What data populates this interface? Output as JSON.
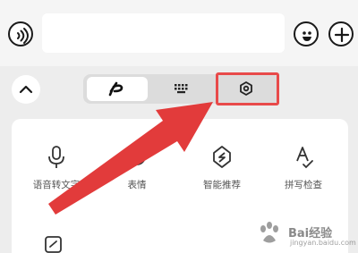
{
  "top_bar": {
    "voice_icon": "voice-wave-icon",
    "emoji_icon": "smiley-icon",
    "plus_icon": "plus-icon",
    "input_value": ""
  },
  "keyboard_toolbar": {
    "collapse_icon": "chevron-up-icon",
    "tabs": [
      {
        "icon": "handwriting-icon",
        "selected": true
      },
      {
        "icon": "keyboard-icon",
        "selected": false
      },
      {
        "icon": "hexagon-settings-icon",
        "selected": false,
        "highlighted": true
      }
    ],
    "highlight_color": "#e84a4a"
  },
  "panel": {
    "tools": [
      {
        "icon": "microphone-icon",
        "label": "语音转文字"
      },
      {
        "icon": "emoji-icon",
        "label": "表情"
      },
      {
        "icon": "smart-recommend-icon",
        "label": "智能推荐"
      },
      {
        "icon": "spell-check-icon",
        "label": "拼写检查"
      },
      {
        "icon": "link-icon",
        "label": ""
      }
    ]
  },
  "annotation": {
    "arrow_color": "#e23b3b"
  },
  "watermark": {
    "text": "Bai经验",
    "subtext": "jingyan.baidu.com"
  }
}
